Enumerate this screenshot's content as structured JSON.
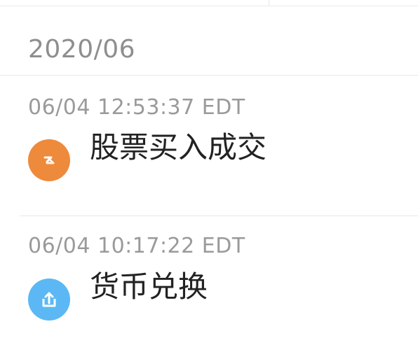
{
  "month_header": {
    "label": "2020/06"
  },
  "records": [
    {
      "time": "06/04 12:53:37 EDT",
      "title": "股票买入成交",
      "icon": "stock-trade-icon",
      "icon_color": "#ee8a3c"
    },
    {
      "time": "06/04 10:17:22 EDT",
      "title": "货币兑换",
      "icon": "currency-exchange-icon",
      "icon_color": "#5bb8f4"
    }
  ]
}
